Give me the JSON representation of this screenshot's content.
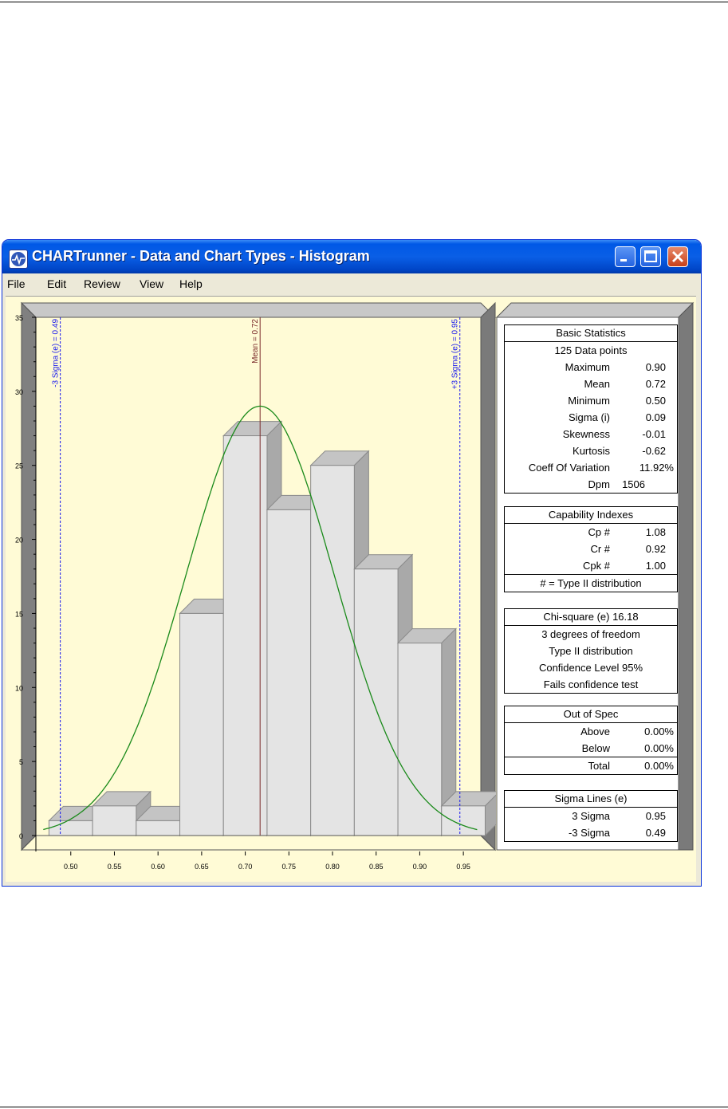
{
  "window": {
    "title": "CHARTrunner - Data and Chart Types - Histogram",
    "buttons": [
      "minimize",
      "maximize",
      "close"
    ]
  },
  "menu": [
    "File",
    "Edit",
    "Review",
    "View",
    "Help"
  ],
  "chart_data": {
    "type": "bar",
    "title": "",
    "xlabel": "",
    "ylabel": "",
    "bin_edges": [
      0.475,
      0.525,
      0.575,
      0.625,
      0.675,
      0.725,
      0.775,
      0.825,
      0.875,
      0.925,
      0.975
    ],
    "values": [
      1,
      2,
      1,
      15,
      27,
      22,
      25,
      18,
      13,
      2
    ],
    "xlim": [
      0.46,
      0.97
    ],
    "ylim": [
      0,
      35
    ],
    "x_ticks": [
      "0.50",
      "0.55",
      "0.60",
      "0.65",
      "0.70",
      "0.75",
      "0.80",
      "0.85",
      "0.90",
      "0.95"
    ],
    "y_ticks": [
      "0",
      "5",
      "10",
      "15",
      "20",
      "25",
      "30",
      "35"
    ],
    "normal_curve": {
      "mean": 0.717,
      "sigma": 0.085,
      "peak": 29,
      "color": "#1a8a1a"
    },
    "reference_lines": [
      {
        "label": "Mean = 0.72",
        "x": 0.717,
        "color": "#7a2a2a",
        "style": "solid"
      },
      {
        "label": "-3 Sigma (e) = 0.49",
        "x": 0.488,
        "color": "#1a1aee",
        "style": "dashed"
      },
      {
        "label": "+3 Sigma (e) = 0.95",
        "x": 0.946,
        "color": "#1a1aee",
        "style": "dashed"
      }
    ],
    "bar_color": "#e4e4e4",
    "grid": false
  },
  "stats": {
    "basic": {
      "header": "Basic Statistics",
      "count_line": "125 Data points",
      "rows": [
        {
          "label": "Maximum",
          "value": "0.90"
        },
        {
          "label": "Mean",
          "value": "0.72"
        },
        {
          "label": "Minimum",
          "value": "0.50"
        },
        {
          "label": "Sigma (i)",
          "value": "0.09"
        },
        {
          "label": "Skewness",
          "value": "-0.01"
        },
        {
          "label": "Kurtosis",
          "value": "-0.62"
        },
        {
          "label": "Coeff Of Variation",
          "value": "11.92%"
        },
        {
          "label": "Dpm",
          "value": "1506"
        }
      ]
    },
    "capability": {
      "header": "Capability Indexes",
      "rows": [
        {
          "label": "Cp #",
          "value": "1.08"
        },
        {
          "label": "Cr #",
          "value": "0.92"
        },
        {
          "label": "Cpk #",
          "value": "1.00"
        }
      ],
      "footer": "# = Type II distribution"
    },
    "chi": {
      "header": "Chi-square (e) 16.18",
      "lines": [
        "3 degrees of freedom",
        "Type II distribution",
        "Confidence Level 95%",
        "Fails confidence test"
      ]
    },
    "spec": {
      "header": "Out of Spec",
      "rows": [
        {
          "label": "Above",
          "value": "0.00%"
        },
        {
          "label": "Below",
          "value": "0.00%"
        }
      ],
      "total": {
        "label": "Total",
        "value": "0.00%"
      }
    },
    "sigma_lines": {
      "header": "Sigma Lines (e)",
      "rows": [
        {
          "label": "3 Sigma",
          "value": "0.95"
        },
        {
          "label": "-3 Sigma",
          "value": "0.49"
        }
      ]
    }
  }
}
